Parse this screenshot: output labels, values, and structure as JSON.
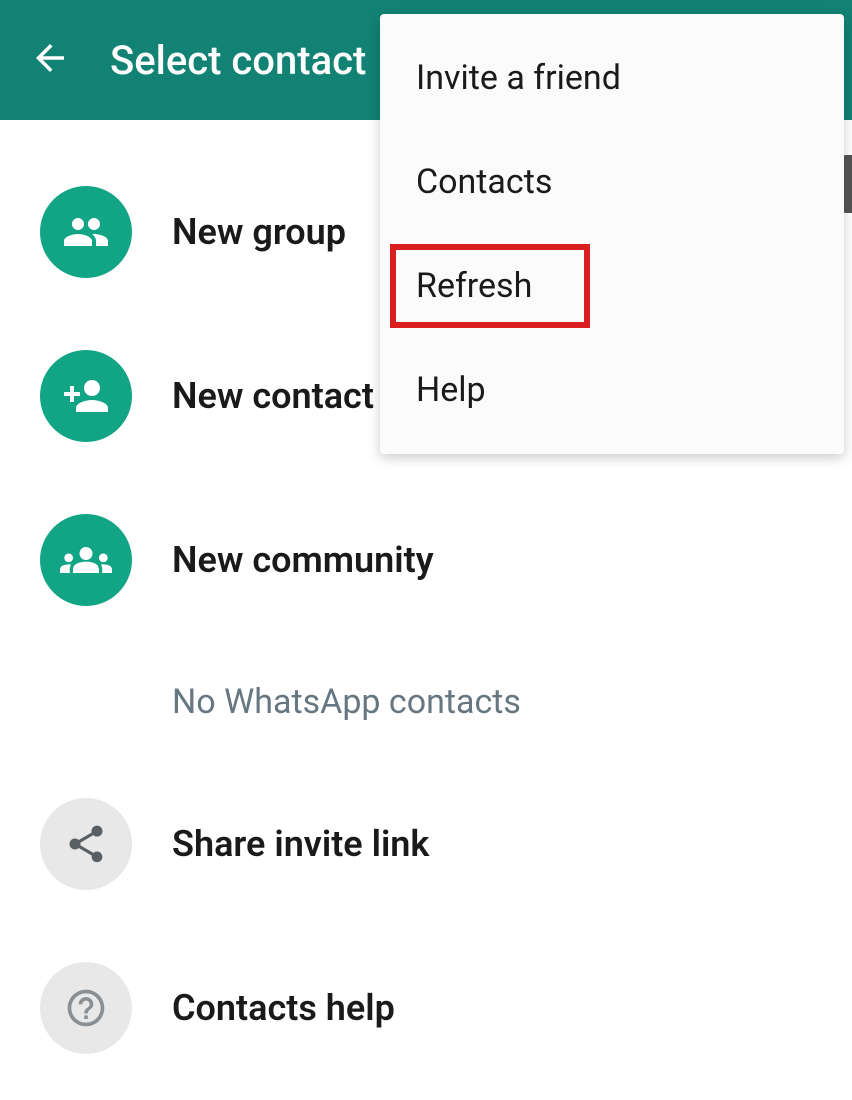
{
  "header": {
    "title": "Select contact"
  },
  "menu": {
    "items": [
      {
        "label": "Invite a friend"
      },
      {
        "label": "Contacts"
      },
      {
        "label": "Refresh"
      },
      {
        "label": "Help"
      }
    ]
  },
  "actions": {
    "new_group": "New group",
    "new_contact": "New contact",
    "new_community": "New community",
    "share_invite": "Share invite link",
    "contacts_help": "Contacts help"
  },
  "empty_state": "No WhatsApp contacts"
}
